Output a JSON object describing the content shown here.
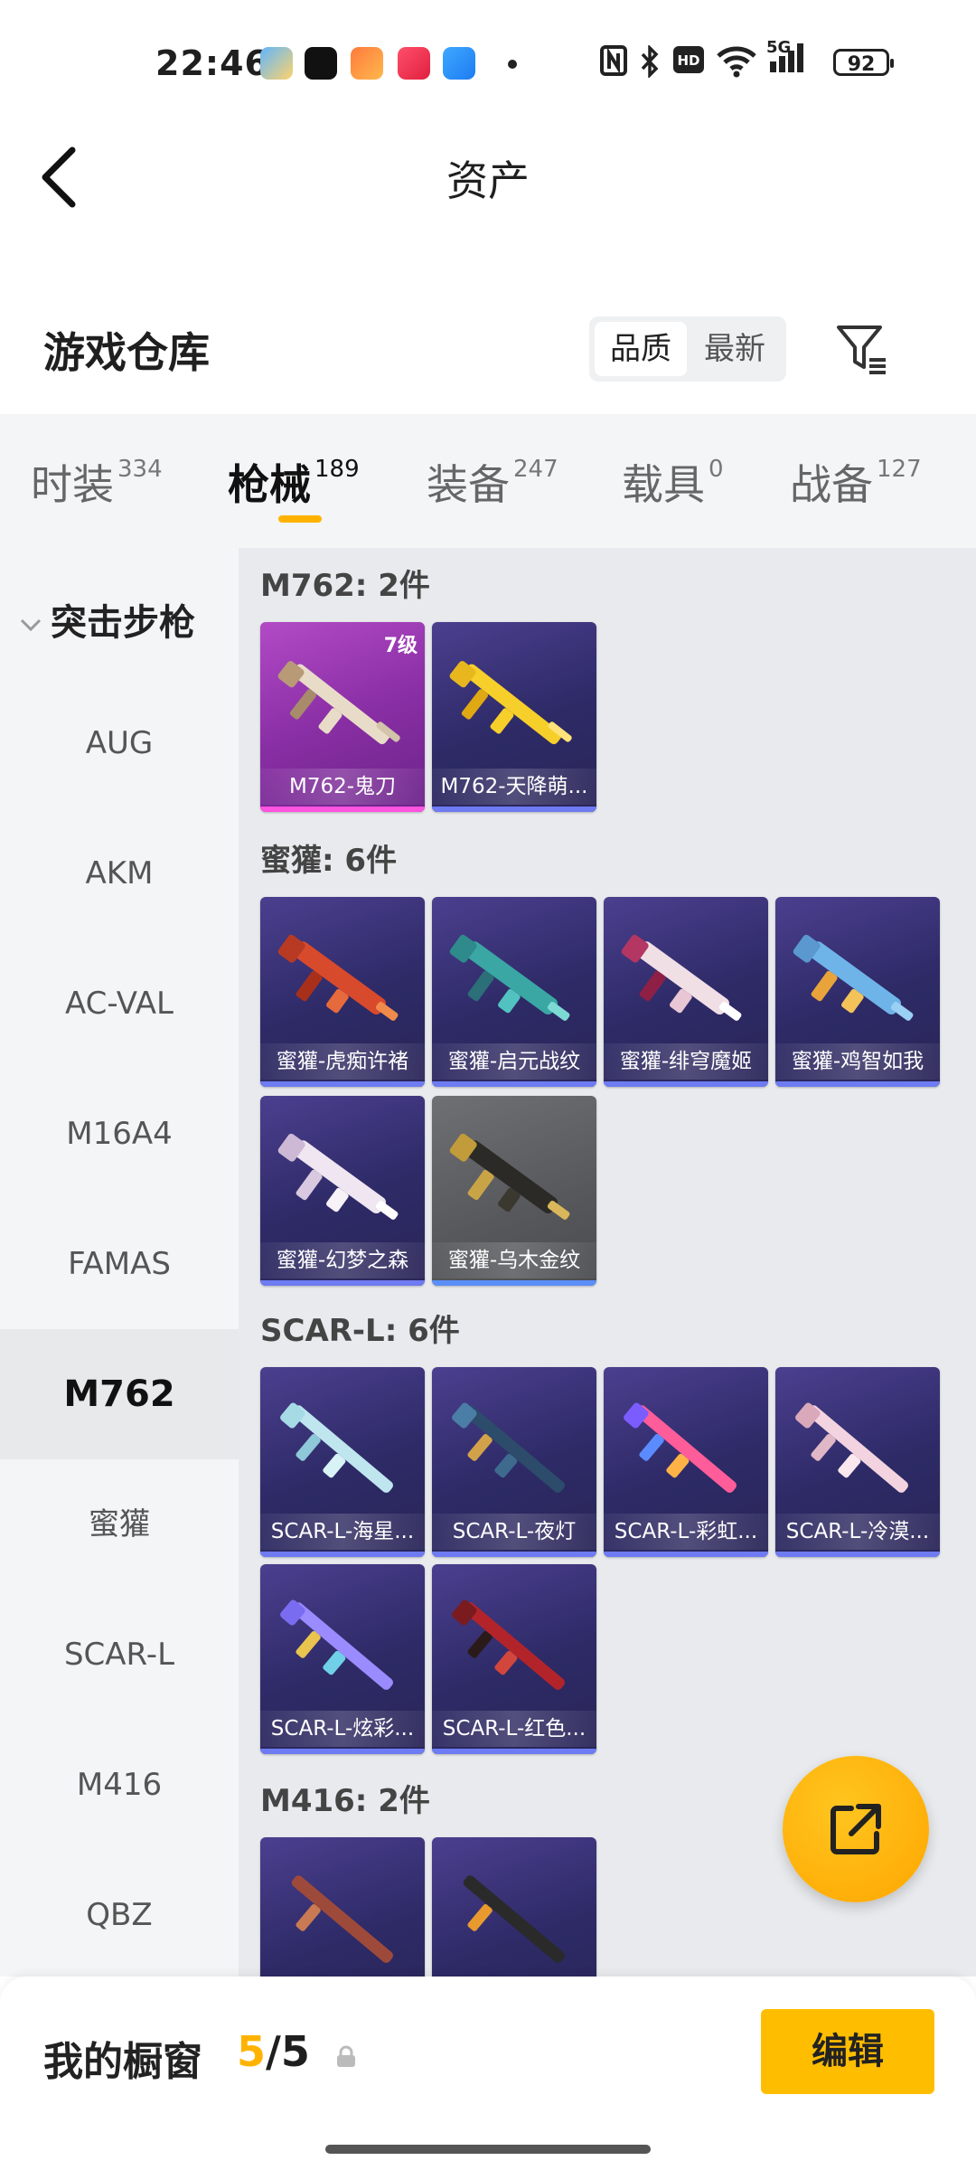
{
  "status_bar": {
    "time": "22:46",
    "right_icons": [
      "nfc-icon",
      "bluetooth-icon",
      "hd-icon",
      "wifi-icon",
      "signal-5g-icon"
    ],
    "network": "5G",
    "battery": "92"
  },
  "header": {
    "title": "资产"
  },
  "section": {
    "title": "游戏仓库",
    "sort_options": [
      "品质",
      "最新"
    ]
  },
  "tabs": [
    {
      "label": "时装",
      "count": "334"
    },
    {
      "label": "枪械",
      "count": "189"
    },
    {
      "label": "装备",
      "count": "247"
    },
    {
      "label": "载具",
      "count": "0"
    },
    {
      "label": "战备",
      "count": "127"
    }
  ],
  "sidebar": {
    "category": "突击步枪",
    "items": [
      "AUG",
      "AKM",
      "AC-VAL",
      "M16A4",
      "FAMAS",
      "M762",
      "蜜獾",
      "SCAR-L",
      "M416",
      "QBZ"
    ]
  },
  "groups": [
    {
      "title": "M762: 2件",
      "items": [
        {
          "name": "M762-鬼刀",
          "level": "7级"
        },
        {
          "name": "M762-天降萌..."
        }
      ]
    },
    {
      "title": "蜜獾: 6件",
      "items": [
        {
          "name": "蜜獾-虎痴许褚"
        },
        {
          "name": "蜜獾-启元战纹"
        },
        {
          "name": "蜜獾-绯穹魔姬"
        },
        {
          "name": "蜜獾-鸡智如我"
        },
        {
          "name": "蜜獾-幻梦之森"
        },
        {
          "name": "蜜獾-乌木金纹"
        }
      ]
    },
    {
      "title": "SCAR-L: 6件",
      "items": [
        {
          "name": "SCAR-L-海星..."
        },
        {
          "name": "SCAR-L-夜灯"
        },
        {
          "name": "SCAR-L-彩虹..."
        },
        {
          "name": "SCAR-L-冷漠..."
        },
        {
          "name": "SCAR-L-炫彩..."
        },
        {
          "name": "SCAR-L-红色..."
        }
      ]
    },
    {
      "title": "M416: 2件",
      "items": [
        {
          "name": ""
        },
        {
          "name": ""
        }
      ]
    }
  ],
  "showcase": {
    "label": "我的橱窗",
    "current": "5",
    "separator": "/",
    "total": "5",
    "edit_label": "编辑"
  },
  "colors": {
    "accent": "#ffb300",
    "card_blue": "#2d2a66",
    "card_purple": "#8a2fa5",
    "card_gray": "#57585c"
  }
}
